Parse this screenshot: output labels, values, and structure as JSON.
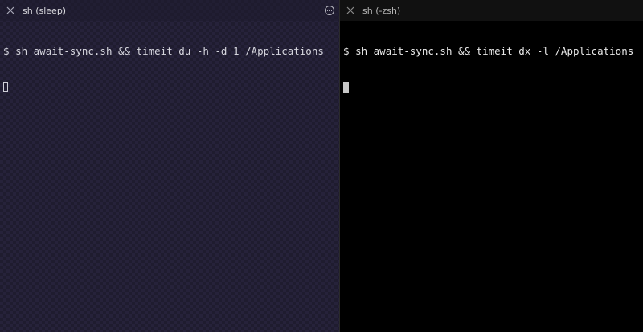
{
  "panes": [
    {
      "tab_title": "sh (sleep)",
      "prompt": "$",
      "command": "sh await-sync.sh && timeit du -h -d 1 /Applications",
      "cursor_style": "outline",
      "background": "#26223a"
    },
    {
      "tab_title": "sh (-zsh)",
      "prompt": "$",
      "command": "sh await-sync.sh && timeit dx -l /Applications",
      "cursor_style": "block",
      "background": "#000000"
    }
  ],
  "icons": {
    "close": "close-icon",
    "menu": "more-options-icon"
  }
}
